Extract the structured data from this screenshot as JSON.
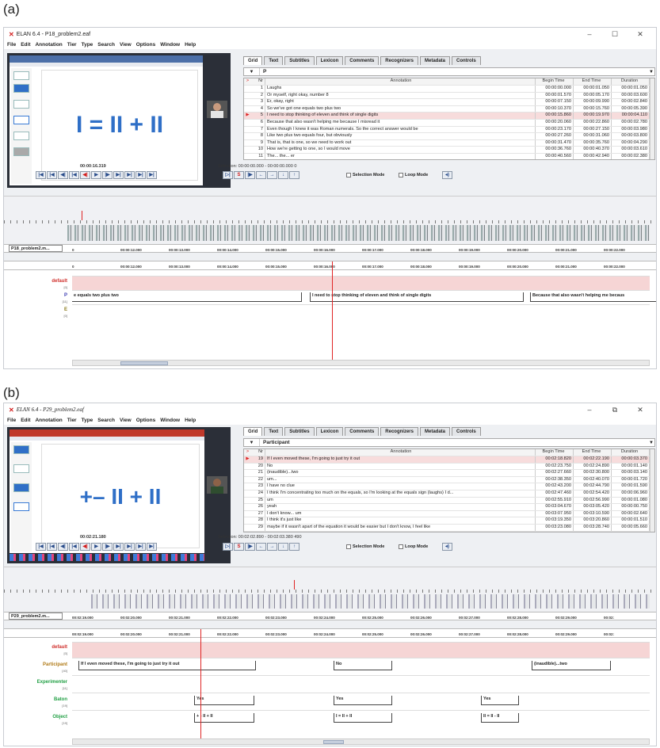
{
  "panels": [
    {
      "label": "(a)",
      "window_title": "ELAN 6.4 - P18_problem2.eaf",
      "controls": [
        "–",
        "☐",
        "✕"
      ],
      "menu": [
        "File",
        "Edit",
        "Annotation",
        "Tier",
        "Type",
        "Search",
        "View",
        "Options",
        "Window",
        "Help"
      ],
      "video_equation": "I = II + II",
      "tabs": [
        "Grid",
        "Text",
        "Subtitles",
        "Lexicon",
        "Comments",
        "Recognizers",
        "Metadata",
        "Controls"
      ],
      "tier_selected": "P",
      "table_headers": [
        "Nr",
        "Annotation",
        "Begin Time",
        "End Time",
        "Duration"
      ],
      "rows": [
        {
          "nr": "1",
          "ann": "Laughs",
          "begin": "00:00:00.000",
          "end": "00:00:01.050",
          "dur": "00:00:01.050"
        },
        {
          "nr": "2",
          "ann": "Or myself, right okay, number 8",
          "begin": "00:00:01.570",
          "end": "00:00:05.170",
          "dur": "00:00:03.600"
        },
        {
          "nr": "3",
          "ann": "Er, okay, right",
          "begin": "00:00:07.150",
          "end": "00:00:09.990",
          "dur": "00:00:02.840"
        },
        {
          "nr": "4",
          "ann": "So we've got one equals two plus two",
          "begin": "00:00:10.370",
          "end": "00:00:15.760",
          "dur": "00:00:05.390"
        },
        {
          "nr": "5",
          "ann": "I need to stop thinking of eleven and think of single digits",
          "begin": "00:00:15.860",
          "end": "00:00:19.970",
          "dur": "00:00:04.110"
        },
        {
          "nr": "6",
          "ann": "Because that also wasn't helping me because I misread it",
          "begin": "00:00:20.060",
          "end": "00:00:22.860",
          "dur": "00:00:02.780"
        },
        {
          "nr": "7",
          "ann": "Even though I knew it was Roman numerals. So the correct answer would be",
          "begin": "00:00:23.170",
          "end": "00:00:27.150",
          "dur": "00:00:03.980"
        },
        {
          "nr": "8",
          "ann": "Like two plus two equals four, but obviously",
          "begin": "00:00:27.260",
          "end": "00:00:31.060",
          "dur": "00:00:03.800"
        },
        {
          "nr": "9",
          "ann": "That is, that is one, so we need to work out",
          "begin": "00:00:31.470",
          "end": "00:00:35.760",
          "dur": "00:00:04.290"
        },
        {
          "nr": "10",
          "ann": "How we're getting to one, so I would move",
          "begin": "00:00:36.760",
          "end": "00:00:40.370",
          "dur": "00:00:03.610"
        },
        {
          "nr": "11",
          "ann": "The... the... er",
          "begin": "00:00:40.560",
          "end": "00:00:42.940",
          "dur": "00:00:02.380"
        }
      ],
      "current_time": "00:00:16.319",
      "selection": "Selection: 00:00:00.000 - 00:00:00.000  0",
      "selection_mode": "Selection Mode",
      "loop_mode": "Loop Mode",
      "tier_select_box": "P18_problem2.m...",
      "ruler_ticks": [
        "0",
        "00:00:12.000",
        "00:00:13.000",
        "00:00:14.000",
        "00:00:15.000",
        "00:00:16.000",
        "00:00:17.000",
        "00:00:18.000",
        "00:00:19.000",
        "00:00:20.000",
        "00:00:21.000",
        "00:00:22.000"
      ],
      "tiers": [
        {
          "name": "default",
          "count": "[0]",
          "color": "#d0312d"
        },
        {
          "name": "P",
          "count": "[11]",
          "color": "#3b3bb3"
        },
        {
          "name": "E",
          "count": "[0]",
          "color": "#8a7a1a"
        }
      ],
      "segments": [
        "e equals two plus two",
        "I need to stop thinking of eleven and think of single digits",
        "Because that also wasn't helping me becaus"
      ]
    },
    {
      "label": "(b)",
      "window_title": "ELAN 6.4 - P29_problem2.eaf",
      "controls": [
        "–",
        "⧉",
        "✕"
      ],
      "menu": [
        "File",
        "Edit",
        "Annotation",
        "Tier",
        "Type",
        "Search",
        "View",
        "Options",
        "Window",
        "Help"
      ],
      "video_equation": "+– II + II",
      "tabs": [
        "Grid",
        "Text",
        "Subtitles",
        "Lexicon",
        "Comments",
        "Recognizers",
        "Metadata",
        "Controls"
      ],
      "tier_selected": "Participant",
      "table_headers": [
        "Nr",
        "Annotation",
        "Begin Time",
        "End Time",
        "Duration"
      ],
      "rows": [
        {
          "nr": "19",
          "ann": "If I even moved these, I'm going to just try it out",
          "begin": "00:02:18.820",
          "end": "00:02:22.190",
          "dur": "00:00:03.370"
        },
        {
          "nr": "20",
          "ann": "No",
          "begin": "00:02:23.750",
          "end": "00:02:24.890",
          "dur": "00:00:01.140"
        },
        {
          "nr": "21",
          "ann": "(inaudible)...two",
          "begin": "00:02:27.660",
          "end": "00:02:30.800",
          "dur": "00:00:03.140"
        },
        {
          "nr": "22",
          "ann": "um...",
          "begin": "00:02:38.350",
          "end": "00:02:40.070",
          "dur": "00:00:01.720"
        },
        {
          "nr": "23",
          "ann": "I have no clue",
          "begin": "00:02:43.200",
          "end": "00:02:44.790",
          "dur": "00:00:01.590"
        },
        {
          "nr": "24",
          "ann": "I think I'm concentrating too much on the equals, so I'm looking at the equals sign (laughs) I d...",
          "begin": "00:02:47.460",
          "end": "00:02:54.420",
          "dur": "00:00:06.960"
        },
        {
          "nr": "25",
          "ann": "um",
          "begin": "00:02:55.910",
          "end": "00:02:56.990",
          "dur": "00:00:01.080"
        },
        {
          "nr": "26",
          "ann": "yeah",
          "begin": "00:03:04.670",
          "end": "00:03:05.420",
          "dur": "00:00:00.750"
        },
        {
          "nr": "27",
          "ann": "I don't know... um",
          "begin": "00:03:07.950",
          "end": "00:03:10.590",
          "dur": "00:00:02.640"
        },
        {
          "nr": "28",
          "ann": "I think it's just like",
          "begin": "00:03:19.350",
          "end": "00:03:20.860",
          "dur": "00:00:01.510"
        },
        {
          "nr": "29",
          "ann": "maybe if it wasn't apart of the equation it would be easier but I don't know, I feel like",
          "begin": "00:03:23.080",
          "end": "00:03:28.740",
          "dur": "00:00:05.660"
        }
      ],
      "current_time": "00:02:21.180",
      "selection": "Selection: 00:02:02.890 - 00:02:03.380  490",
      "selection_mode": "Selection Mode",
      "loop_mode": "Loop Mode",
      "tier_select_box": "P29_problem2.m...",
      "ruler_ticks": [
        "00:02:19.000",
        "00:02:20.000",
        "00:02:21.000",
        "00:02:22.000",
        "00:02:23.000",
        "00:02:24.000",
        "00:02:25.000",
        "00:02:26.000",
        "00:02:27.000",
        "00:02:28.000",
        "00:02:29.000",
        "00:02:"
      ],
      "tiers": [
        {
          "name": "default",
          "count": "[0]",
          "color": "#d0312d"
        },
        {
          "name": "Participant",
          "count": "[40]",
          "color": "#b07a16"
        },
        {
          "name": "Experimenter",
          "count": "[11]",
          "color": "#22a045"
        },
        {
          "name": "Baton",
          "count": "[19]",
          "color": "#22a045"
        },
        {
          "name": "Object",
          "count": "[19]",
          "color": "#22a045"
        }
      ],
      "participant_segments": [
        "If I even moved these, I'm going to just try it out",
        "No",
        "(inaudible)...two"
      ],
      "baton_segments": [
        "Yes",
        "Yes",
        "Yes"
      ],
      "object_segments": [
        "+ - II + II",
        "I = II + II",
        "II = II - II"
      ]
    }
  ],
  "media_buttons": [
    "|◀",
    "|◀",
    "◀|",
    "|◀",
    "◀|",
    "▶",
    "|▶",
    "▶|",
    "▶|",
    "▶|",
    "▶|"
  ],
  "extra_buttons": [
    "▷|",
    "S",
    "|▶",
    "←",
    "→",
    "↓",
    "↑"
  ]
}
